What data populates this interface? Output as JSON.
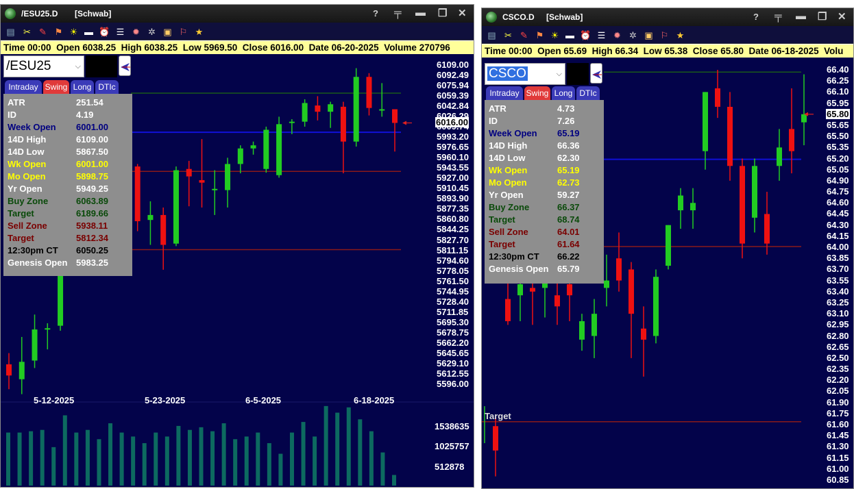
{
  "colors": {
    "chart_bg": "#03034a",
    "up": "#22cc22",
    "down": "#ee1111",
    "week_open_line": "#1010d8",
    "target_red_line": "#8a1a1a",
    "target_green_line": "#1a5a1a",
    "volume": "#0d6a60",
    "infobar_bg": "#ffff9a"
  },
  "left": {
    "title": "/ESU25.D",
    "source": "[Schwab]",
    "infobar": {
      "time": "Time 00:00",
      "open": "Open 6038.25",
      "high": "High 6038.25",
      "low": "Low 5969.50",
      "close": "Close 6016.00",
      "date": "Date 06-20-2025",
      "volume": "Volume 270796"
    },
    "symbol": "/ESU25",
    "tabs": [
      "Intraday",
      "Swing",
      "Long",
      "DTIc"
    ],
    "stats": [
      {
        "label": "ATR",
        "value": "251.54",
        "color": "#ffffff"
      },
      {
        "label": "ID",
        "value": "4.19",
        "color": "#ffffff"
      },
      {
        "label": "Week Open",
        "value": "6001.00",
        "color": "#000080"
      },
      {
        "label": "14D High",
        "value": "6109.00",
        "color": "#ffffff"
      },
      {
        "label": "14D Low",
        "value": "5867.50",
        "color": "#ffffff"
      },
      {
        "label": "Wk Open",
        "value": "6001.00",
        "color": "#ffff00"
      },
      {
        "label": "Mo Open",
        "value": "5898.75",
        "color": "#ffff00"
      },
      {
        "label": "Yr Open",
        "value": "5949.25",
        "color": "#ffffff"
      },
      {
        "label": "Buy Zone",
        "value": "6063.89",
        "color": "#0a4a0a"
      },
      {
        "label": "Target",
        "value": "6189.66",
        "color": "#0a4a0a"
      },
      {
        "label": "Sell Zone",
        "value": "5938.11",
        "color": "#7a0000"
      },
      {
        "label": "Target",
        "value": "5812.34",
        "color": "#7a0000"
      },
      {
        "label": "12:30pm CT",
        "value": "6050.25",
        "color": "#000000"
      },
      {
        "label": "Genesis Open",
        "value": "5983.25",
        "color": "#ffffff"
      }
    ],
    "price_labels": [
      "6109.00",
      "6092.49",
      "6075.94",
      "6059.39",
      "6042.84",
      "6026.29",
      "6009.74",
      "5993.20",
      "5976.65",
      "5960.10",
      "5943.55",
      "5927.00",
      "5910.45",
      "5893.90",
      "5877.35",
      "5860.80",
      "5844.25",
      "5827.70",
      "5811.15",
      "5794.60",
      "5778.05",
      "5761.50",
      "5744.95",
      "5728.40",
      "5711.85",
      "5695.30",
      "5678.75",
      "5662.20",
      "5645.65",
      "5629.10",
      "5612.55",
      "5596.00"
    ],
    "current_price": "6016.00",
    "date_labels": [
      "5-12-2025",
      "5-23-2025",
      "6-5-2025",
      "6-18-2025"
    ],
    "volume_labels": [
      "1538635",
      "1025757",
      "512878"
    ],
    "price_range": [
      5596.0,
      6109.0
    ],
    "lines": {
      "week_open": 6001.0,
      "green_target": 6063.89,
      "red_sell": 5938.11,
      "red_target": 5812.34
    },
    "candles": [
      {
        "o": 5628,
        "h": 5646,
        "l": 5588,
        "c": 5610
      },
      {
        "o": 5604,
        "h": 5672,
        "l": 5580,
        "c": 5632
      },
      {
        "o": 5634,
        "h": 5708,
        "l": 5622,
        "c": 5684
      },
      {
        "o": 5684,
        "h": 5694,
        "l": 5652,
        "c": 5686
      },
      {
        "o": 5690,
        "h": 5818,
        "l": 5682,
        "c": 5794
      },
      {
        "o": 5800,
        "h": 5872,
        "l": 5796,
        "c": 5864
      },
      {
        "o": 5864,
        "h": 5906,
        "l": 5850,
        "c": 5898
      },
      {
        "o": 5900,
        "h": 5930,
        "l": 5878,
        "c": 5918
      },
      {
        "o": 5920,
        "h": 5960,
        "l": 5908,
        "c": 5954
      },
      {
        "o": 5978,
        "h": 5992,
        "l": 5940,
        "c": 5954
      },
      {
        "o": 5946,
        "h": 5950,
        "l": 5842,
        "c": 5858
      },
      {
        "o": 5860,
        "h": 5890,
        "l": 5820,
        "c": 5868
      },
      {
        "o": 5868,
        "h": 5880,
        "l": 5780,
        "c": 5820
      },
      {
        "o": 5822,
        "h": 5946,
        "l": 5818,
        "c": 5940
      },
      {
        "o": 5942,
        "h": 5955,
        "l": 5882,
        "c": 5930
      },
      {
        "o": 5924,
        "h": 5990,
        "l": 5880,
        "c": 5920
      },
      {
        "o": 5908,
        "h": 5940,
        "l": 5868,
        "c": 5910
      },
      {
        "o": 5908,
        "h": 5960,
        "l": 5880,
        "c": 5950
      },
      {
        "o": 5950,
        "h": 5980,
        "l": 5935,
        "c": 5975
      },
      {
        "o": 5975,
        "h": 5986,
        "l": 5965,
        "c": 5980
      },
      {
        "o": 5942,
        "h": 6010,
        "l": 5936,
        "c": 6005
      },
      {
        "o": 5932,
        "h": 6026,
        "l": 5928,
        "c": 6014
      },
      {
        "o": 6016,
        "h": 6022,
        "l": 5998,
        "c": 6018
      },
      {
        "o": 6018,
        "h": 6054,
        "l": 6010,
        "c": 6048
      },
      {
        "o": 6044,
        "h": 6059,
        "l": 6020,
        "c": 6034
      },
      {
        "o": 6034,
        "h": 6050,
        "l": 6008,
        "c": 6046
      },
      {
        "o": 6042,
        "h": 6050,
        "l": 5935,
        "c": 5986
      },
      {
        "o": 5986,
        "h": 6104,
        "l": 5978,
        "c": 6090
      },
      {
        "o": 6090,
        "h": 6096,
        "l": 6028,
        "c": 6040
      },
      {
        "o": 6036,
        "h": 6080,
        "l": 6026,
        "c": 6038
      },
      {
        "o": 6038,
        "h": 6038,
        "l": 5970,
        "c": 6016
      }
    ],
    "volumes": [
      0.4,
      0.4,
      0.41,
      0.42,
      0.29,
      0.53,
      0.4,
      0.42,
      0.35,
      0.47,
      0.4,
      0.37,
      0.32,
      0.4,
      0.37,
      0.45,
      0.42,
      0.44,
      0.41,
      0.47,
      0.35,
      0.37,
      0.4,
      0.32,
      0.24,
      0.4,
      0.48,
      0.37,
      0.6,
      0.55,
      0.59,
      0.5,
      0.41,
      0.25,
      0.08
    ]
  },
  "right": {
    "title": "CSCO.D",
    "source": "[Schwab]",
    "infobar": {
      "time": "Time 00:00",
      "open": "Open 65.69",
      "high": "High 66.34",
      "low": "Low 65.38",
      "close": "Close 65.80",
      "date": "Date 06-18-2025",
      "volume": "Volu"
    },
    "symbol": "CSCO",
    "tabs": [
      "Intraday",
      "Swing",
      "Long",
      "DTIc"
    ],
    "stats": [
      {
        "label": "ATR",
        "value": "4.73",
        "color": "#ffffff"
      },
      {
        "label": "ID",
        "value": "7.26",
        "color": "#ffffff"
      },
      {
        "label": "Week Open",
        "value": "65.19",
        "color": "#000080"
      },
      {
        "label": "14D High",
        "value": "66.36",
        "color": "#ffffff"
      },
      {
        "label": "14D Low",
        "value": "62.30",
        "color": "#ffffff"
      },
      {
        "label": "Wk Open",
        "value": "65.19",
        "color": "#ffff00"
      },
      {
        "label": "Mo Open",
        "value": "62.73",
        "color": "#ffff00"
      },
      {
        "label": "Yr Open",
        "value": "59.27",
        "color": "#ffffff"
      },
      {
        "label": "Buy Zone",
        "value": "66.37",
        "color": "#0a4a0a"
      },
      {
        "label": "Target",
        "value": "68.74",
        "color": "#0a4a0a"
      },
      {
        "label": "Sell Zone",
        "value": "64.01",
        "color": "#7a0000"
      },
      {
        "label": "Target",
        "value": "61.64",
        "color": "#7a0000"
      },
      {
        "label": "12:30pm CT",
        "value": "66.22",
        "color": "#000000"
      },
      {
        "label": "Genesis Open",
        "value": "65.79",
        "color": "#ffffff"
      }
    ],
    "price_labels": [
      "66.40",
      "66.25",
      "66.10",
      "65.95",
      "65.80",
      "65.65",
      "65.50",
      "65.35",
      "65.20",
      "65.05",
      "64.90",
      "64.75",
      "64.60",
      "64.45",
      "64.30",
      "64.15",
      "64.00",
      "63.85",
      "63.70",
      "63.55",
      "63.40",
      "63.25",
      "63.10",
      "62.95",
      "62.80",
      "62.65",
      "62.50",
      "62.35",
      "62.20",
      "62.05",
      "61.90",
      "61.75",
      "61.60",
      "61.45",
      "61.30",
      "61.15",
      "61.00",
      "60.85"
    ],
    "current_price": "65.80",
    "target_label": "Target",
    "price_range": [
      60.85,
      66.4
    ],
    "lines": {
      "week_open": 65.19,
      "green_target": 66.37,
      "red_sell": 64.01,
      "red_target": 61.64
    },
    "candles": [
      {
        "o": 61.58,
        "h": 61.7,
        "l": 60.9,
        "c": 61.25
      },
      {
        "o": 63.3,
        "h": 63.75,
        "l": 62.95,
        "c": 63.0
      },
      {
        "o": 63.35,
        "h": 63.8,
        "l": 63.0,
        "c": 63.5
      },
      {
        "o": 63.45,
        "h": 63.8,
        "l": 62.95,
        "c": 63.4
      },
      {
        "o": 63.45,
        "h": 63.75,
        "l": 63.05,
        "c": 63.55
      },
      {
        "o": 63.35,
        "h": 63.65,
        "l": 62.95,
        "c": 63.2
      },
      {
        "o": 63.5,
        "h": 63.75,
        "l": 63.0,
        "c": 63.35
      },
      {
        "o": 62.75,
        "h": 63.1,
        "l": 62.6,
        "c": 63.0
      },
      {
        "o": 62.8,
        "h": 63.3,
        "l": 62.5,
        "c": 63.1
      },
      {
        "o": 63.45,
        "h": 63.9,
        "l": 63.2,
        "c": 63.55
      },
      {
        "o": 63.85,
        "h": 64.2,
        "l": 63.4,
        "c": 63.55
      },
      {
        "o": 63.7,
        "h": 63.8,
        "l": 62.5,
        "c": 63.1
      },
      {
        "o": 62.9,
        "h": 63.2,
        "l": 62.25,
        "c": 62.75
      },
      {
        "o": 62.8,
        "h": 63.7,
        "l": 62.7,
        "c": 63.6
      },
      {
        "o": 63.75,
        "h": 64.3,
        "l": 63.7,
        "c": 64.3
      },
      {
        "o": 64.5,
        "h": 64.8,
        "l": 64.25,
        "c": 64.7
      },
      {
        "o": 64.5,
        "h": 64.8,
        "l": 64.25,
        "c": 64.6
      },
      {
        "o": 65.3,
        "h": 66.1,
        "l": 65.05,
        "c": 66.1
      },
      {
        "o": 66.15,
        "h": 66.4,
        "l": 65.75,
        "c": 65.9
      },
      {
        "o": 65.9,
        "h": 66.1,
        "l": 64.9,
        "c": 65.1
      },
      {
        "o": 65.1,
        "h": 65.2,
        "l": 63.85,
        "c": 64.05
      },
      {
        "o": 64.4,
        "h": 65.2,
        "l": 64.2,
        "c": 65.1
      },
      {
        "o": 64.45,
        "h": 64.75,
        "l": 63.9,
        "c": 64.05
      },
      {
        "o": 65.1,
        "h": 65.6,
        "l": 64.9,
        "c": 65.35
      },
      {
        "o": 65.6,
        "h": 66.15,
        "l": 65.0,
        "c": 65.3
      },
      {
        "o": 65.69,
        "h": 66.34,
        "l": 65.38,
        "c": 65.8
      }
    ]
  }
}
